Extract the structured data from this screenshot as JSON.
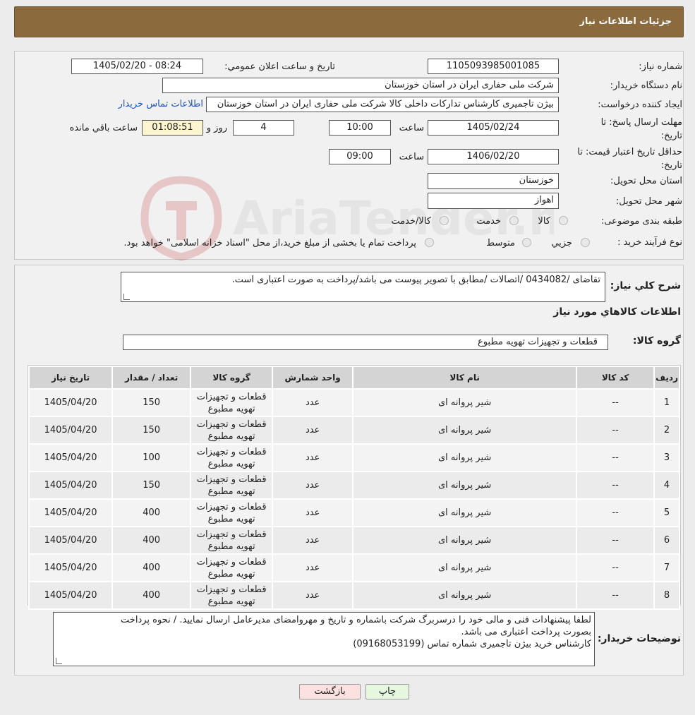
{
  "title": "جزئیات اطلاعات نیاز",
  "watermark_text": "AriaTender.neT",
  "fields": {
    "need_number_label": "شماره نیاز:",
    "need_number": "1105093985001085",
    "announce_label": "تاریخ و ساعت اعلان عمومي:",
    "announce_value": "1405/02/20 - 08:24",
    "buyer_org_label": "نام دستگاه خریدار:",
    "buyer_org": "شرکت ملی حفاری ایران در استان خوزستان",
    "requester_label": "ایجاد کننده درخواست:",
    "requester": "بیژن تاجمیری کارشناس تدارکات داخلی کالا شرکت ملی حفاری ایران در استان خوزستان",
    "contact_link": "اطلاعات تماس خریدار",
    "deadline_label": "مهلت ارسال پاسخ: تا تاریخ:",
    "deadline_date": "1405/02/24",
    "time_label": "ساعت",
    "deadline_time": "10:00",
    "days_value": "4",
    "days_label": "روز و",
    "remaining_value": "01:08:51",
    "remaining_label": "ساعت باقي مانده",
    "validity_label": "حداقل تاریخ اعتبار قیمت: تا تاریخ:",
    "validity_date": "1406/02/20",
    "validity_time": "09:00",
    "province_label": "استان محل تحویل:",
    "province": "خوزستان",
    "city_label": "شهر محل تحویل:",
    "city": "اهواز",
    "category_label": "طبقه بندی موضوعی:",
    "category_options": [
      "کالا",
      "خدمت",
      "کالا/خدمت"
    ],
    "process_label": "نوع فرآیند خرید :",
    "process_options": [
      "جزیي",
      "متوسط"
    ],
    "process_note": "پرداخت تمام یا بخشی از مبلغ خرید،از محل \"اسناد خزانه اسلامی\" خواهد بود."
  },
  "summary": {
    "label": "شرح کلي نیاز:",
    "text": "تقاضای /0434082 /اتصالات /مطابق با تصویر پیوست می باشد/پرداخت به صورت اعتباری است."
  },
  "goods": {
    "section_title": "اطلاعات کالاهاي مورد نیاز",
    "group_label": "گروه کالا:",
    "group_value": "قطعات و تجهیزات تهویه مطبوع",
    "columns": [
      "ردیف",
      "کد کالا",
      "نام کالا",
      "واحد شمارش",
      "گروه کالا",
      "تعداد / مقدار",
      "تاریخ نیاز"
    ],
    "rows": [
      {
        "idx": "1",
        "code": "--",
        "name": "شیر پروانه ای",
        "unit": "عدد",
        "group1": "قطعات و تجهیزات",
        "group2": "تهویه مطبوع",
        "qty": "150",
        "date": "1405/04/20"
      },
      {
        "idx": "2",
        "code": "--",
        "name": "شیر پروانه ای",
        "unit": "عدد",
        "group1": "قطعات و تجهیزات",
        "group2": "تهویه مطبوع",
        "qty": "150",
        "date": "1405/04/20"
      },
      {
        "idx": "3",
        "code": "--",
        "name": "شیر پروانه ای",
        "unit": "عدد",
        "group1": "قطعات و تجهیزات",
        "group2": "تهویه مطبوع",
        "qty": "100",
        "date": "1405/04/20"
      },
      {
        "idx": "4",
        "code": "--",
        "name": "شیر پروانه ای",
        "unit": "عدد",
        "group1": "قطعات و تجهیزات",
        "group2": "تهویه مطبوع",
        "qty": "150",
        "date": "1405/04/20"
      },
      {
        "idx": "5",
        "code": "--",
        "name": "شیر پروانه ای",
        "unit": "عدد",
        "group1": "قطعات و تجهیزات",
        "group2": "تهویه مطبوع",
        "qty": "400",
        "date": "1405/04/20"
      },
      {
        "idx": "6",
        "code": "--",
        "name": "شیر پروانه ای",
        "unit": "عدد",
        "group1": "قطعات و تجهیزات",
        "group2": "تهویه مطبوع",
        "qty": "400",
        "date": "1405/04/20"
      },
      {
        "idx": "7",
        "code": "--",
        "name": "شیر پروانه ای",
        "unit": "عدد",
        "group1": "قطعات و تجهیزات",
        "group2": "تهویه مطبوع",
        "qty": "400",
        "date": "1405/04/20"
      },
      {
        "idx": "8",
        "code": "--",
        "name": "شیر پروانه ای",
        "unit": "عدد",
        "group1": "قطعات و تجهیزات",
        "group2": "تهویه مطبوع",
        "qty": "400",
        "date": "1405/04/20"
      }
    ]
  },
  "buyer_notes": {
    "label": "توضیحات خریدار:",
    "line1": "لطفا پیشنهادات فنی و مالی خود را درسربرگ شرکت باشماره و تاریخ و مهروامضای مدیرعامل ارسال نمایید. / نحوه پرداخت",
    "line2": "بصورت پرداخت اعتباری می باشد.",
    "line3": "کارشناس خرید بیژن تاجمیری شماره تماس (09168053199)"
  },
  "buttons": {
    "print": "چاپ",
    "back": "بازگشت"
  },
  "colors": {
    "header_bg": "#8b6a3e",
    "link": "#2255bb",
    "remaining_bg": "#fdf5cf",
    "back_bg": "#fde0e0",
    "print_bg": "#e6f7e0"
  }
}
